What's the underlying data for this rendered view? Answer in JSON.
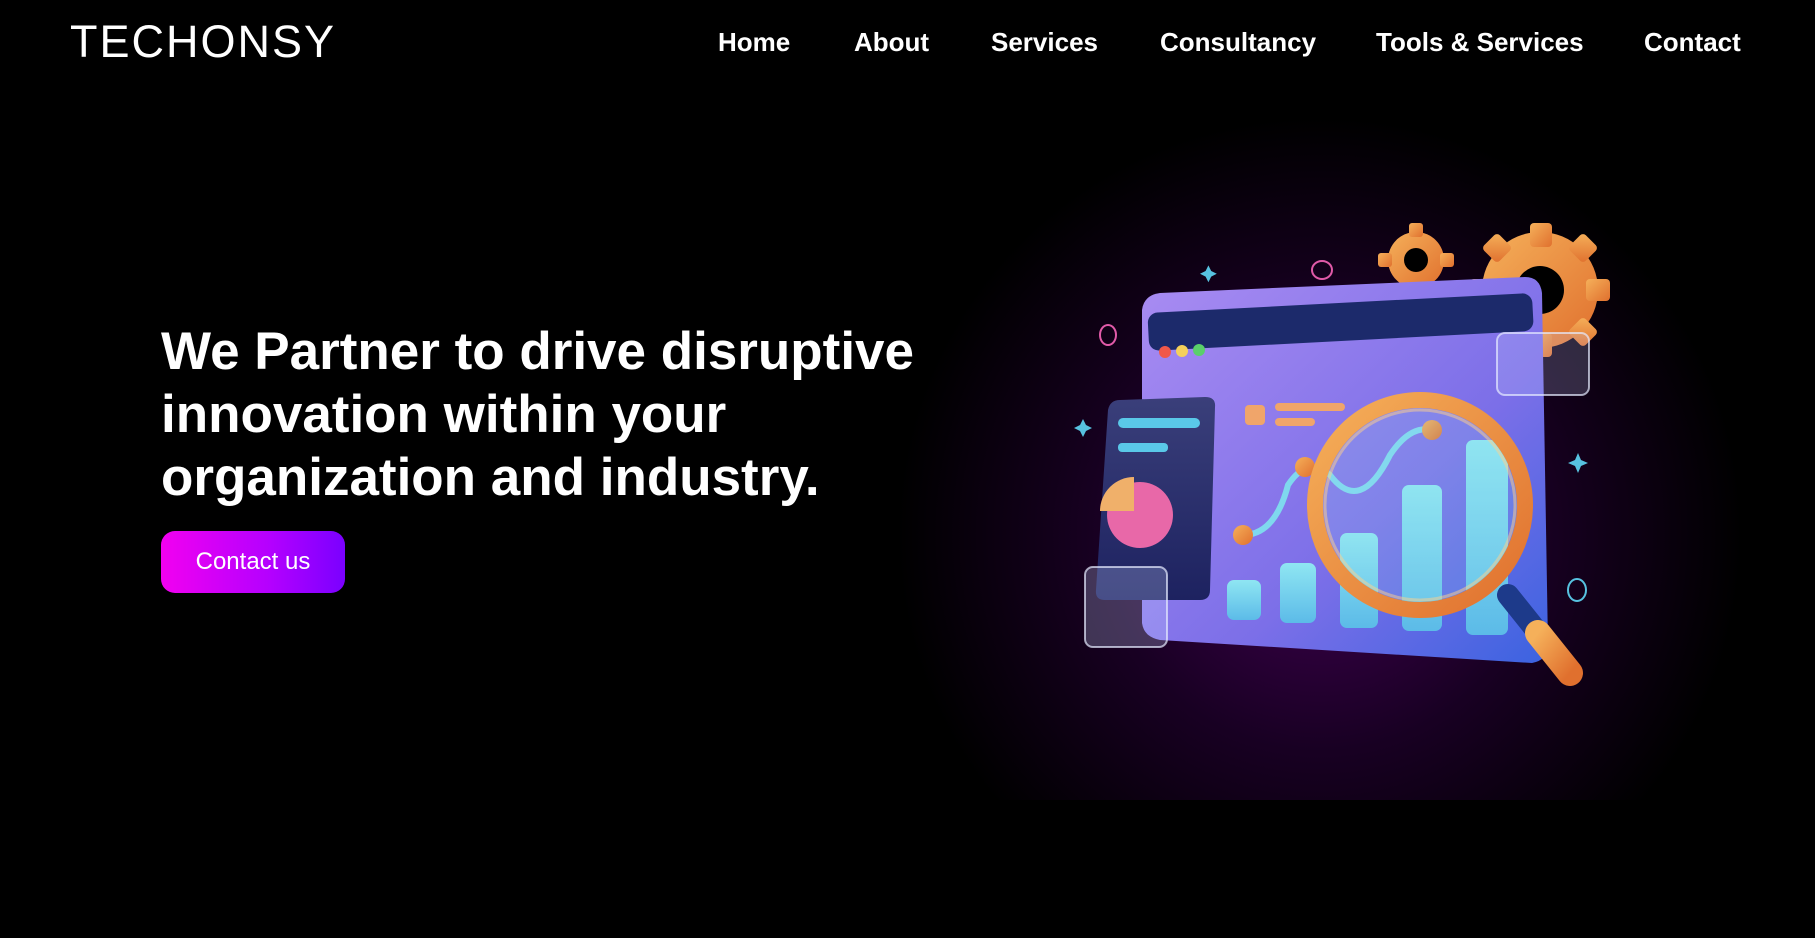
{
  "brand": {
    "logo_text": "TECHONSY"
  },
  "nav": {
    "items": [
      {
        "label": "Home"
      },
      {
        "label": "About"
      },
      {
        "label": "Services"
      },
      {
        "label": "Consultancy"
      },
      {
        "label": "Tools & Services"
      },
      {
        "label": "Contact"
      }
    ]
  },
  "hero": {
    "title": "We Partner to drive disruptive innovation within your organization and industry.",
    "cta_label": "Contact us"
  },
  "colors": {
    "background": "#000000",
    "cta_gradient_start": "#f200f0",
    "cta_gradient_end": "#7a00ff",
    "glow": "#780096"
  },
  "illustration": {
    "icon": "analytics-dashboard-magnifier-illustration"
  }
}
